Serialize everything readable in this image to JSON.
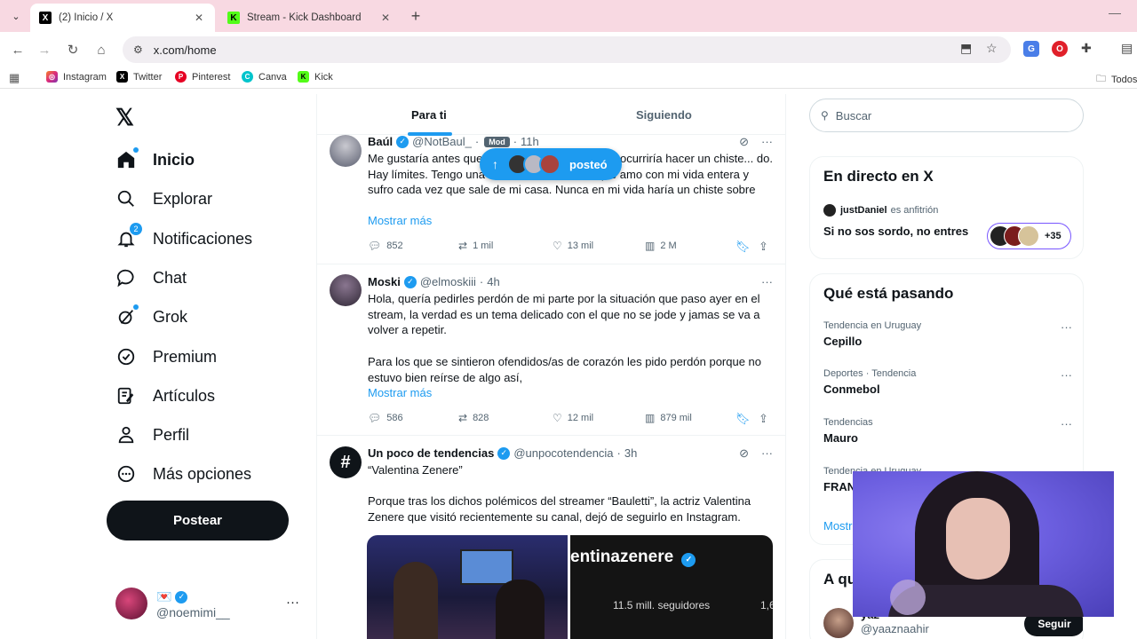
{
  "browser": {
    "tabs": [
      {
        "title": "(2) Inicio / X",
        "favicon": "x-icon"
      },
      {
        "title": "Stream - Kick Dashboard",
        "favicon": "kick-icon"
      }
    ],
    "url": "x.com/home",
    "bookmarks": [
      "Instagram",
      "Twitter",
      "Pinterest",
      "Canva",
      "Kick"
    ],
    "bookmark_folder": "Todos"
  },
  "sidebar": {
    "items": [
      {
        "label": "Inicio",
        "icon": "home-icon"
      },
      {
        "label": "Explorar",
        "icon": "search-icon"
      },
      {
        "label": "Notificaciones",
        "icon": "bell-icon",
        "badge": "2"
      },
      {
        "label": "Chat",
        "icon": "chat-icon"
      },
      {
        "label": "Grok",
        "icon": "grok-icon"
      },
      {
        "label": "Premium",
        "icon": "verified-icon"
      },
      {
        "label": "Artículos",
        "icon": "articles-icon"
      },
      {
        "label": "Perfil",
        "icon": "person-icon"
      },
      {
        "label": "Más opciones",
        "icon": "more-circle-icon"
      }
    ],
    "post_label": "Postear",
    "account": {
      "name": "💌",
      "handle": "@noemimi__"
    }
  },
  "timeline": {
    "tabs": [
      "Para ti",
      "Siguiendo"
    ],
    "posted_pill": "posteó",
    "tweets": [
      {
        "name": "Baúl",
        "handle": "@NotBaul_",
        "badge": "Mod",
        "time": "11h",
        "text": "Me gustaría antes que... jamás en mi vida se me ocurriría hacer un chiste... do. Hay límites. Tengo una hermana de 20 años que amo con mi vida entera y sufro cada vez que sale de mi casa. Nunca en mi vida haría un chiste sobre",
        "more": "Mostrar más",
        "replies": "852",
        "reposts": "1 mil",
        "likes": "13 mil",
        "views": "2 M"
      },
      {
        "name": "Moski",
        "handle": "@elmoskiii",
        "time": "4h",
        "text": "Hola, quería pedirles perdón de mi parte por la situación que paso ayer en el stream, la verdad es un tema delicado con el que no se jode y jamas se va a volver a repetir.",
        "text2": "Para los que se sintieron ofendidos/as de corazón les pido perdón porque no estuvo bien reírse de algo así,",
        "more": "Mostrar más",
        "replies": "586",
        "reposts": "828",
        "likes": "12 mil",
        "views": "879 mil"
      },
      {
        "name": "Un poco de tendencias",
        "handle": "@unpocotendencia",
        "time": "3h",
        "text": "“Valentina Zenere”",
        "text2": "Porque tras los dichos polémicos del streamer “Bauletti”, la actriz Valentina Zenere que visitó recientemente su canal, dejó de seguirlo en Instagram.",
        "media_right_title": "entinazenere",
        "media_right_followers": "11.5 mill. seguidores",
        "media_right_extra": "1,6"
      }
    ]
  },
  "right": {
    "search_placeholder": "Buscar",
    "live": {
      "title": "En directo en X",
      "host": "justDaniel",
      "host_suffix": "es anfitrión",
      "space_title": "Si no sos sordo, no entres",
      "listeners": "+35"
    },
    "trends": {
      "title": "Qué está pasando",
      "items": [
        {
          "context": "Tendencia en Uruguay",
          "name": "Cepillo"
        },
        {
          "context": "Deportes · Tendencia",
          "name": "Conmebol"
        },
        {
          "context": "Tendencias",
          "name": "Mauro"
        },
        {
          "context": "Tendencia en Uruguay",
          "name": "FRAN"
        }
      ],
      "show_more": "Mostr"
    },
    "who_to_follow": {
      "title": "A qu",
      "name": "yaz",
      "handle": "@yaaznaahir",
      "follow_label": "Seguir"
    }
  },
  "colors": {
    "accent": "#1d9bf0",
    "text": "#0f1419",
    "muted": "#536471",
    "tabbar": "#f8d9e2"
  }
}
